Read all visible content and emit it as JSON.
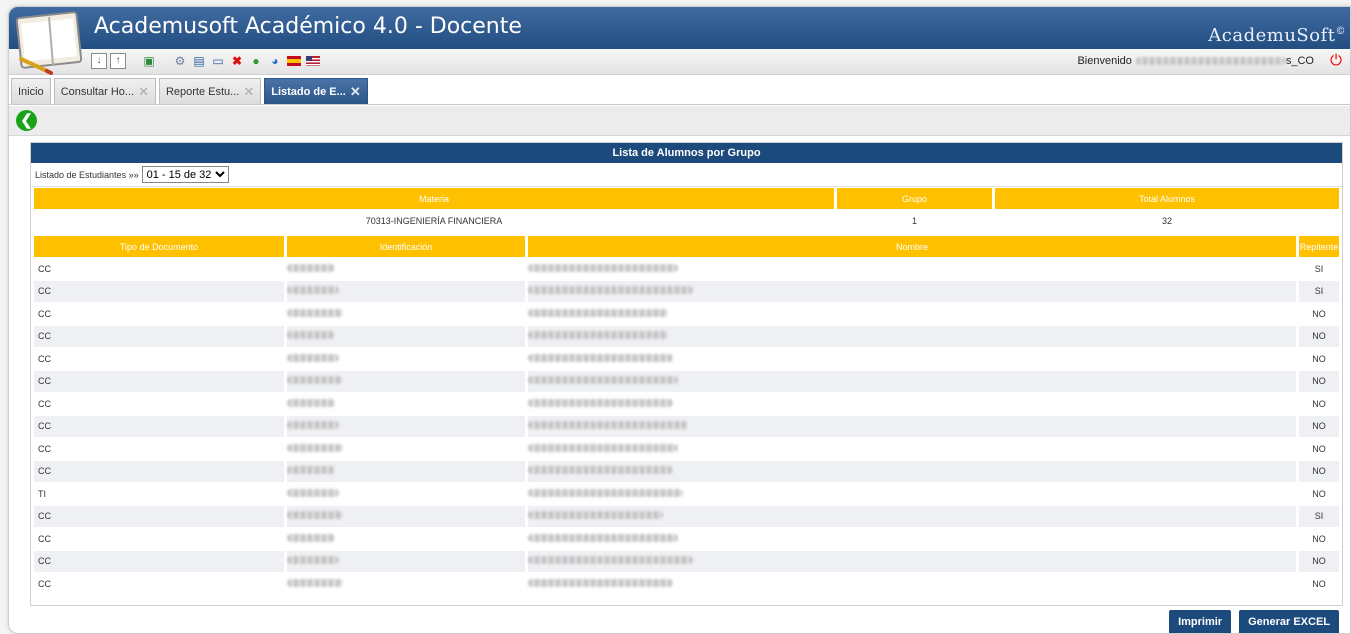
{
  "app": {
    "title": "Academusoft Académico 4.0 - Docente",
    "brand": "AcademuSoft",
    "brand_mark": "©"
  },
  "toolbar": {
    "icons": [
      "download-icon",
      "upload-icon",
      "play-icon",
      "settings-icon",
      "monitor-icon",
      "window-icon",
      "delete-icon",
      "globe-icon",
      "web-icon",
      "spain-flag-icon",
      "usa-flag-icon"
    ],
    "welcome_label": "Bienvenido",
    "welcome_user_suffix": "s_CO"
  },
  "tabs": [
    {
      "label": "Inicio",
      "closable": false,
      "active": false
    },
    {
      "label": "Consultar Ho...",
      "closable": true,
      "active": false
    },
    {
      "label": "Reporte Estu...",
      "closable": true,
      "active": false
    },
    {
      "label": "Listado de E...",
      "closable": true,
      "active": true
    }
  ],
  "panel": {
    "title": "Lista de Alumnos por Grupo",
    "pager_label": "Listado de Estudiantes »»",
    "pager_value": "01 - 15 de 32"
  },
  "course": {
    "headers": {
      "materia": "Materia",
      "grupo": "Grupo",
      "total": "Total Alumnos"
    },
    "materia": "70313-INGENIERÍA FINANCIERA",
    "grupo": "1",
    "total": "32"
  },
  "students": {
    "headers": {
      "tipo": "Tipo de Documento",
      "id": "Identificación",
      "nombre": "Nombre",
      "repitente": "Repitente"
    },
    "rows": [
      {
        "tipo": "CC",
        "repitente": "SI"
      },
      {
        "tipo": "CC",
        "repitente": "SI"
      },
      {
        "tipo": "CC",
        "repitente": "NO"
      },
      {
        "tipo": "CC",
        "repitente": "NO"
      },
      {
        "tipo": "CC",
        "repitente": "NO"
      },
      {
        "tipo": "CC",
        "repitente": "NO"
      },
      {
        "tipo": "CC",
        "repitente": "NO"
      },
      {
        "tipo": "CC",
        "repitente": "NO"
      },
      {
        "tipo": "CC",
        "repitente": "NO"
      },
      {
        "tipo": "CC",
        "repitente": "NO"
      },
      {
        "tipo": "TI",
        "repitente": "NO"
      },
      {
        "tipo": "CC",
        "repitente": "SI"
      },
      {
        "tipo": "CC",
        "repitente": "NO"
      },
      {
        "tipo": "CC",
        "repitente": "NO"
      },
      {
        "tipo": "CC",
        "repitente": "NO"
      }
    ]
  },
  "actions": {
    "print": "Imprimir",
    "excel": "Generar EXCEL"
  },
  "colors": {
    "navy": "#1d4a7c",
    "header_gold": "#ffc000",
    "back_green": "#1aa31a",
    "power_red": "#e00000"
  }
}
